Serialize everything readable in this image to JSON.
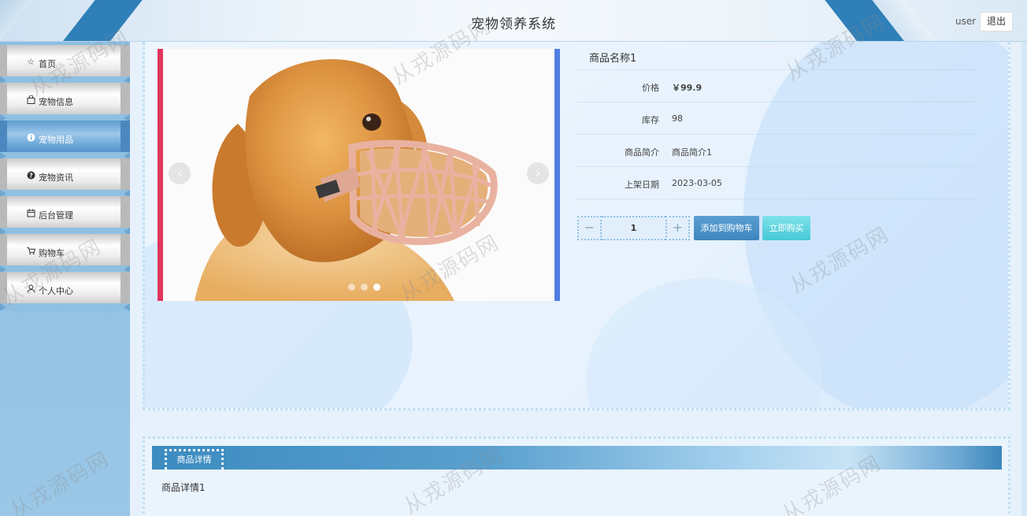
{
  "header": {
    "title": "宠物领养系统",
    "user": "user",
    "logout_label": "退出"
  },
  "sidebar": {
    "items": [
      {
        "label": "首页",
        "icon": "star-outline-icon",
        "active": false
      },
      {
        "label": "宠物信息",
        "icon": "bag-icon",
        "active": false
      },
      {
        "label": "宠物用品",
        "icon": "info-circle-icon",
        "active": true
      },
      {
        "label": "宠物资讯",
        "icon": "question-circle-icon",
        "active": false
      },
      {
        "label": "后台管理",
        "icon": "calendar-icon",
        "active": false
      },
      {
        "label": "购物车",
        "icon": "cart-icon",
        "active": false
      },
      {
        "label": "个人中心",
        "icon": "user-icon",
        "active": false
      }
    ]
  },
  "product": {
    "name": "商品名称1",
    "fields": [
      {
        "key": "价格",
        "value": "￥99.9"
      },
      {
        "key": "库存",
        "value": "98"
      },
      {
        "key": "商品简介",
        "value": "商品简介1"
      },
      {
        "key": "上架日期",
        "value": "2023-03-05"
      }
    ],
    "quantity": "1",
    "add_to_cart_label": "添加到购物车",
    "buy_now_label": "立即购买",
    "carousel": {
      "prev_icon": "chevron-left-icon",
      "next_icon": "chevron-right-icon",
      "prev": "‹",
      "next": "›",
      "slide_count": 3,
      "active_slide": 3
    },
    "qty_minus": "−",
    "qty_plus": "+"
  },
  "detail": {
    "tab_label": "商品详情",
    "content": "商品详情1"
  },
  "watermark": "从戎源码网",
  "colors": {
    "accent": "#3e86c0",
    "buy": "#45c9d6",
    "carousel_left_border": "#e0365e",
    "carousel_right_border": "#4f7fe0"
  }
}
